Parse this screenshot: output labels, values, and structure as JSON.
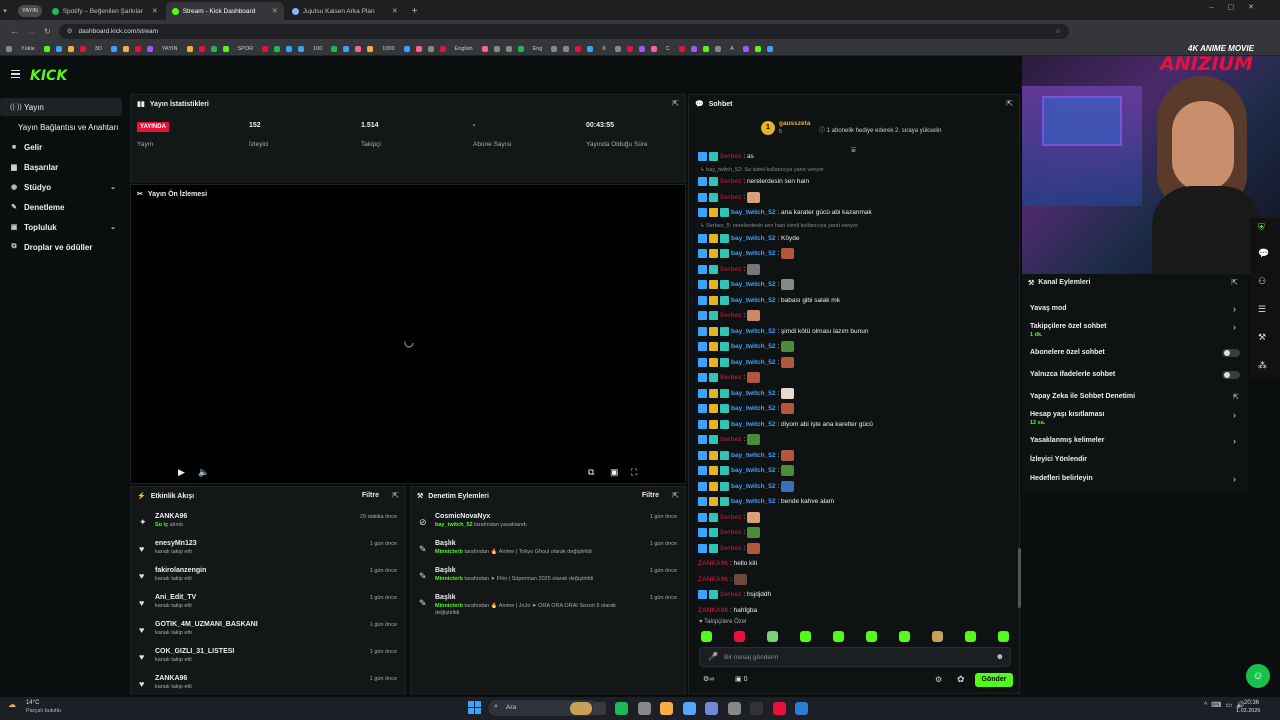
{
  "browser": {
    "tabs": [
      {
        "label": "Spotify – Beğenilen Şarkılar",
        "color": "#1db954",
        "active": false
      },
      {
        "label": "Stream - Kick Dashboard",
        "color": "#53fc18",
        "active": true
      },
      {
        "label": "Jujutsu Kaisen Arka Plan",
        "color": "#8ab4f8",
        "active": false
      }
    ],
    "url": "dashboard.kick.com/stream",
    "pinned_label": "YAYIN",
    "bookmarks": [
      "Yükle",
      "3D",
      "YAYIN",
      "SPOR",
      "100",
      "1000",
      "English",
      "Eng",
      "K",
      "C",
      "A"
    ]
  },
  "overlay": {
    "brand_small": "4K ANIME MOVIE",
    "brand_big": "ANIZIUM"
  },
  "app": {
    "logo": "KICK"
  },
  "sidebar": {
    "items": [
      {
        "label": "Yayın",
        "icon": "broadcast-icon",
        "glyph": "((·))",
        "chevron": false,
        "active": true
      },
      {
        "label": "Yayın Bağlantısı ve Anahtarı",
        "icon": "",
        "glyph": "",
        "chevron": false,
        "active": false
      },
      {
        "label": "Gelir",
        "icon": "dollar-icon",
        "glyph": "■",
        "chevron": false,
        "active": false
      },
      {
        "label": "Başarılar",
        "icon": "trophy-icon",
        "glyph": "▆",
        "chevron": false,
        "active": false
      },
      {
        "label": "Stüdyo",
        "icon": "studio-icon",
        "glyph": "◉",
        "chevron": true,
        "active": false
      },
      {
        "label": "Denetleme",
        "icon": "gavel-icon",
        "glyph": "✎",
        "chevron": false,
        "active": false
      },
      {
        "label": "Topluluk",
        "icon": "community-icon",
        "glyph": "▣",
        "chevron": true,
        "active": false
      },
      {
        "label": "Droplar ve ödüller",
        "icon": "gift-icon",
        "glyph": "⧉",
        "chevron": false,
        "active": false
      }
    ]
  },
  "stats": {
    "title": "Yayın İstatistikleri",
    "live_badge": "YAYINDA",
    "items": [
      {
        "value": "",
        "label": "Yayın"
      },
      {
        "value": "152",
        "label": "İzleyici"
      },
      {
        "value": "1.514",
        "label": "Takipçi"
      },
      {
        "value": "-",
        "label": "Abone Sayısı"
      },
      {
        "value": "00:43:55",
        "label": "Yayında Olduğu Süre"
      }
    ]
  },
  "preview": {
    "title": "Yayın Ön İzlemesi"
  },
  "activity": {
    "title": "Etkinlik Akışı",
    "filter": "Filtre",
    "rows": [
      {
        "name": "ZANKA96",
        "sub": "Su iç",
        "sub_suffix": " alındı",
        "time": "29 dakika önce",
        "icon": "gift-icon"
      },
      {
        "name": "enesyMn123",
        "sub": "",
        "sub_suffix": "kanalı takip etti",
        "time": "1 gün önce",
        "icon": "heart-icon"
      },
      {
        "name": "fakirolanzengin",
        "sub": "",
        "sub_suffix": "kanalı takip etti",
        "time": "1 gün önce",
        "icon": "heart-icon"
      },
      {
        "name": "Ani_Edit_TV",
        "sub": "",
        "sub_suffix": "kanalı takip etti",
        "time": "1 gün önce",
        "icon": "heart-icon"
      },
      {
        "name": "GOTIK_4M_UZMANI_BASKANI",
        "sub": "",
        "sub_suffix": "kanalı takip etti",
        "time": "1 gün önce",
        "icon": "heart-icon"
      },
      {
        "name": "COK_GIZLI_31_LISTESI",
        "sub": "",
        "sub_suffix": "kanalı takip etti",
        "time": "1 gün önce",
        "icon": "heart-icon"
      },
      {
        "name": "ZANKA96",
        "sub": "",
        "sub_suffix": "kanalı takip etti",
        "time": "1 gün önce",
        "icon": "heart-icon"
      }
    ]
  },
  "moderation": {
    "title": "Denetim Eylemleri",
    "filter": "Filtre",
    "rows": [
      {
        "name": "CosmicNovaNyx",
        "actor": "bay_twitch_52",
        "text": " tarafından yasaklandı",
        "time": "1 gün önce",
        "icon": "ban-icon"
      },
      {
        "name": "Başlık",
        "actor": "Minnicterb",
        "text": " tarafından  🔥 Anime | Tokyo Ghoul olarak değiştirildi",
        "time": "1 gün önce",
        "icon": "edit-icon"
      },
      {
        "name": "Başlık",
        "actor": "Minnicterb",
        "text": " tarafından  ➤ Film | Süperman 2025 olarak değiştirildi",
        "time": "1 gün önce",
        "icon": "edit-icon"
      },
      {
        "name": "Başlık",
        "actor": "Minnicterb",
        "text": " tarafından  🔥 Anime | JoJo ➤ ORA ORA ORAI Sezon 5 olarak değiştirildi",
        "time": "1 gün önce",
        "icon": "edit-icon"
      }
    ]
  },
  "chat": {
    "title": "Sohbet",
    "pinned_user": "gausszeta",
    "pinned_count": "5",
    "pinned_text": "1 abonelik hediye ederek 2. sıraya yükselin",
    "followers_only": "Takipçilere Özel",
    "input_placeholder": "Bir mesaj gönderin",
    "send": "Gönder",
    "points": "0",
    "messages": [
      {
        "kind": "msg",
        "user": "Serbez",
        "color": "#e9113c",
        "text": ": as"
      },
      {
        "kind": "reply",
        "text": "bay_twitch_52: Sa isimli kullanıcıya yanıt veriyor"
      },
      {
        "kind": "msg",
        "user": "Serbez",
        "color": "#e9113c",
        "text": ": nerelerdesin sen hain"
      },
      {
        "kind": "msg",
        "user": "Serbez",
        "color": "#e9113c",
        "text": ": ",
        "emote": "#d9a07a"
      },
      {
        "kind": "msg",
        "user": "bay_twitch_52",
        "color": "#3aa3ff",
        "text": ": ana karater gücü abi kazanmak"
      },
      {
        "kind": "reply",
        "text": "Serbez_5: nerelerdesin sen hain isimli kullanıcıya yanıt veriyor"
      },
      {
        "kind": "msg",
        "user": "bay_twitch_52",
        "color": "#3aa3ff",
        "text": ": Köyde"
      },
      {
        "kind": "msg",
        "user": "bay_twitch_52",
        "color": "#3aa3ff",
        "text": ": ",
        "emote": "#b4553e"
      },
      {
        "kind": "msg",
        "user": "Serbez",
        "color": "#e9113c",
        "text": ": ",
        "emote": "#777"
      },
      {
        "kind": "msg",
        "user": "bay_twitch_52",
        "color": "#3aa3ff",
        "text": ": ",
        "emote": "#888"
      },
      {
        "kind": "msg",
        "user": "bay_twitch_52",
        "color": "#3aa3ff",
        "text": ": babası gibi salak mk"
      },
      {
        "kind": "msg",
        "user": "Serbez",
        "color": "#e9113c",
        "text": ": ",
        "emote": "#c98a6a"
      },
      {
        "kind": "msg",
        "user": "bay_twitch_52",
        "color": "#3aa3ff",
        "text": ": şimdi kötü olması lazım bunun"
      },
      {
        "kind": "msg",
        "user": "bay_twitch_52",
        "color": "#3aa3ff",
        "text": ": ",
        "emote": "#4a8c3a"
      },
      {
        "kind": "msg",
        "user": "bay_twitch_52",
        "color": "#3aa3ff",
        "text": ": ",
        "emote": "#b4553e"
      },
      {
        "kind": "msg",
        "user": "Serbez",
        "color": "#e9113c",
        "text": ": ",
        "emote": "#b4553e"
      },
      {
        "kind": "msg",
        "user": "bay_twitch_52",
        "color": "#3aa3ff",
        "text": ": ",
        "emote": "#e8d8d0"
      },
      {
        "kind": "msg",
        "user": "bay_twitch_52",
        "color": "#3aa3ff",
        "text": ": ",
        "emote": "#b4553e"
      },
      {
        "kind": "msg",
        "user": "bay_twitch_52",
        "color": "#3aa3ff",
        "text": ": diyom abi işte ana karelter gücü"
      },
      {
        "kind": "msg",
        "user": "Serbez",
        "color": "#e9113c",
        "text": ": ",
        "emote": "#4a8c3a"
      },
      {
        "kind": "msg",
        "user": "bay_twitch_52",
        "color": "#3aa3ff",
        "text": ": ",
        "emote": "#b4553e"
      },
      {
        "kind": "msg",
        "user": "bay_twitch_52",
        "color": "#3aa3ff",
        "text": ": ",
        "emote": "#4a8c3a"
      },
      {
        "kind": "msg",
        "user": "bay_twitch_52",
        "color": "#3aa3ff",
        "text": ": ",
        "emote": "#3a6fb4"
      },
      {
        "kind": "msg",
        "user": "bay_twitch_52",
        "color": "#3aa3ff",
        "text": ": bende kahve alam"
      },
      {
        "kind": "msg",
        "user": "Serbez",
        "color": "#e9113c",
        "text": ": ",
        "emote": "#d9a07a"
      },
      {
        "kind": "msg",
        "user": "Serbez",
        "color": "#e9113c",
        "text": ": ",
        "emote": "#4a8c3a"
      },
      {
        "kind": "msg",
        "user": "Serbez",
        "color": "#e9113c",
        "text": ": ",
        "emote": "#b4553e"
      },
      {
        "kind": "msg",
        "user": "ZANKA96",
        "color": "#e9113c",
        "text": ": hello kiti",
        "nobadge": true
      },
      {
        "kind": "msg",
        "user": "ZANKA96",
        "color": "#e9113c",
        "text": ": ",
        "emote": "#6a4a3a",
        "nobadge": true
      },
      {
        "kind": "msg",
        "user": "Serbez",
        "color": "#e9113c",
        "text": ": hsjdjddh"
      },
      {
        "kind": "msg",
        "user": "ZANKA96",
        "color": "#e9113c",
        "text": ": hahfgba",
        "nobadge": true
      }
    ],
    "emote_bar": [
      "#53fc18",
      "#e9113c",
      "#7ad37a",
      "#53fc18",
      "#53fc18",
      "#53fc18",
      "#53fc18",
      "#c9a05a",
      "#53fc18",
      "#53fc18"
    ]
  },
  "channel_actions": {
    "title": "Kanal Eylemleri",
    "items": [
      {
        "label": "Yavaş mod",
        "sub": "",
        "control": "chevron"
      },
      {
        "label": "Takipçilere özel sohbet",
        "sub": "1 dk.",
        "control": "chevron"
      },
      {
        "label": "Abonelere özel sohbet",
        "sub": "",
        "control": "toggle"
      },
      {
        "label": "Yalnızca ifadelerle sohbet",
        "sub": "",
        "control": "toggle"
      },
      {
        "label": "Yapay Zeka ile Sohbet Denetimi",
        "sub": "",
        "control": "external"
      },
      {
        "label": "Hesap yaşı kısıtlaması",
        "sub": "12 sa.",
        "control": "chevron"
      },
      {
        "label": "Yasaklanmış kelimeler",
        "sub": "",
        "control": "chevron"
      },
      {
        "label": "İzleyici Yönlendir",
        "sub": "",
        "control": "none"
      },
      {
        "label": "Hedefleri belirleyin",
        "sub": "",
        "control": "chevron"
      }
    ]
  },
  "taskbar": {
    "weather_temp": "14°C",
    "weather_text": "Parçalı bulutlu",
    "search": "Ara",
    "time": "20:36",
    "date": "1.03.2026"
  }
}
